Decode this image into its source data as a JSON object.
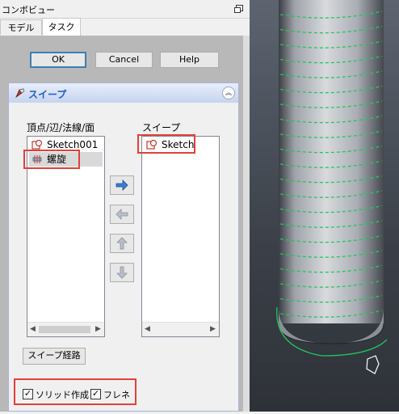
{
  "window": {
    "title": "コンボビュー"
  },
  "tabs": [
    {
      "label": "モデル"
    },
    {
      "label": "タスク"
    }
  ],
  "dialog": {
    "ok_label": "OK",
    "cancel_label": "Cancel",
    "help_label": "Help"
  },
  "sweep": {
    "title": "スイープ",
    "left_header": "頂点/辺/法線/面",
    "right_header": "スイープ",
    "available": [
      {
        "label": "Sketch001",
        "icon": "sketch-icon"
      },
      {
        "label": "螺旋",
        "icon": "helix-icon"
      }
    ],
    "selected": [
      {
        "label": "Sketch",
        "icon": "sketch-icon"
      }
    ],
    "path_button": "スイープ経路",
    "solid_label": "ソリッド作成",
    "frenet_label": "フレネ",
    "solid_checked": true,
    "frenet_checked": true
  },
  "colors": {
    "highlight": "#e0403c",
    "panel_header": "#215dc6",
    "helix": "#22c55e",
    "profile": "#ffffff"
  }
}
